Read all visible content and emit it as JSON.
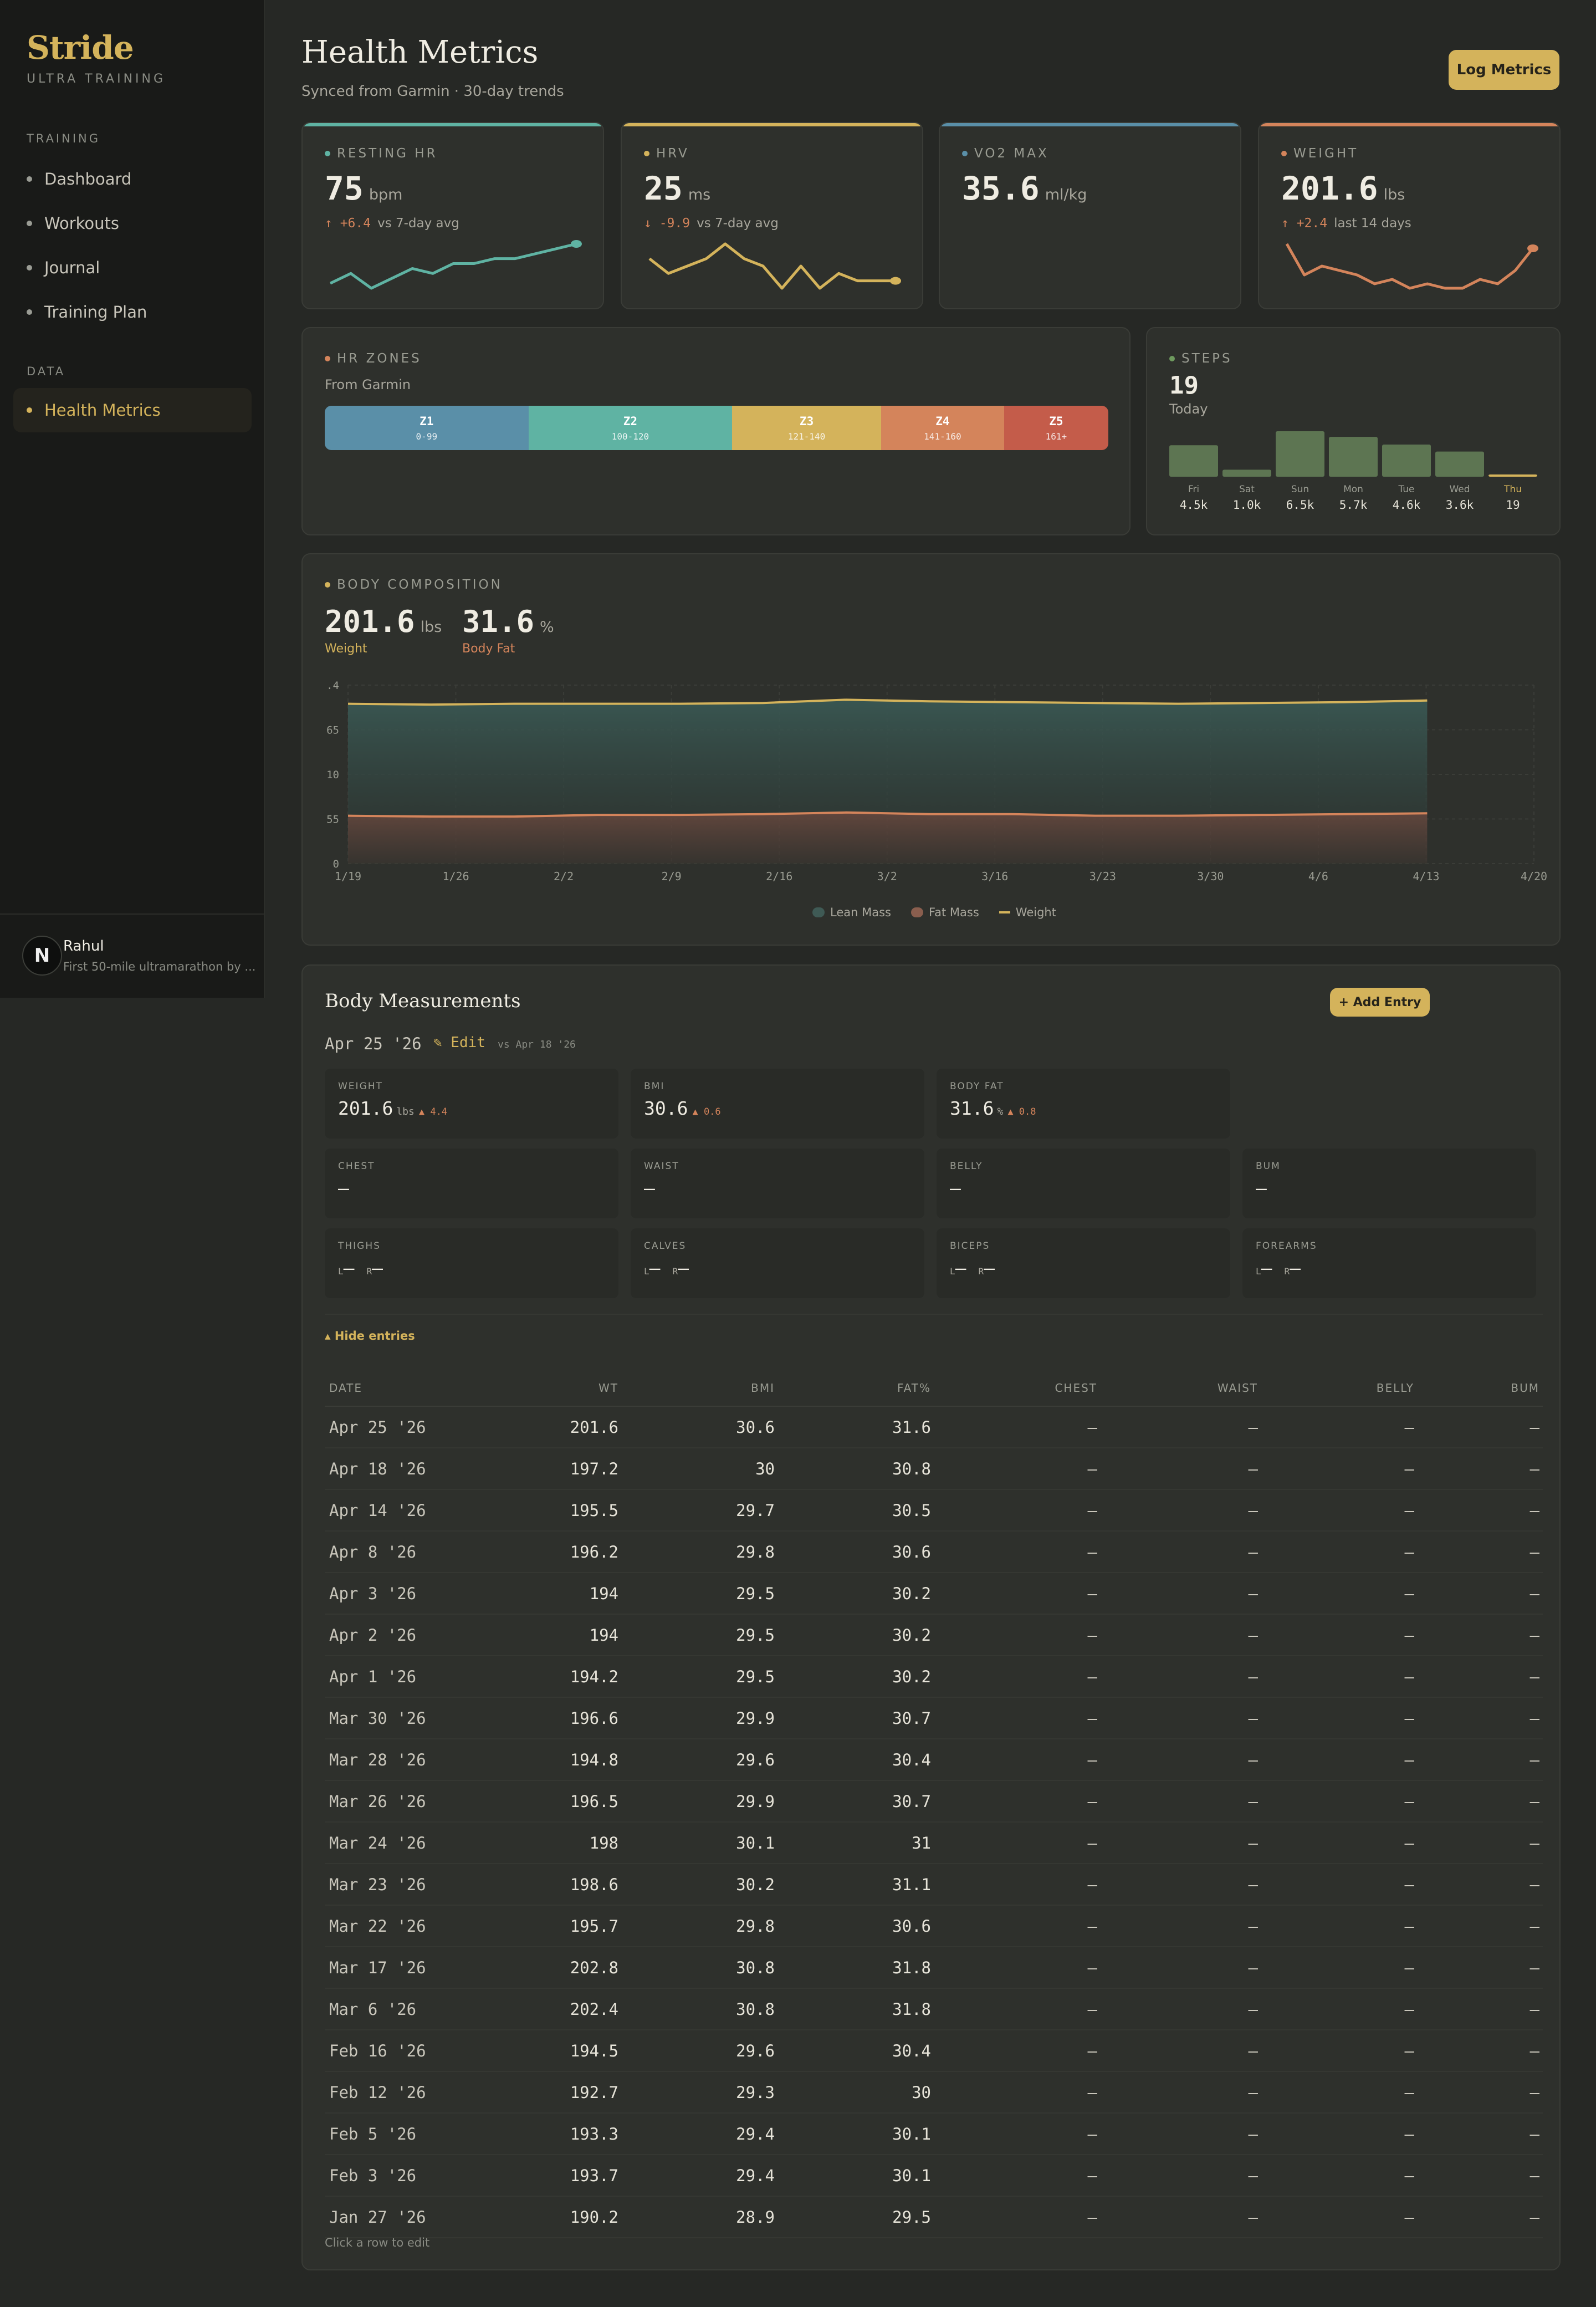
{
  "app": {
    "name": "Stride",
    "tagline": "ULTRA TRAINING"
  },
  "sidebar": {
    "sections": [
      {
        "title": "TRAINING",
        "items": [
          "Dashboard",
          "Workouts",
          "Journal",
          "Training Plan"
        ]
      },
      {
        "title": "DATA",
        "items": [
          "Health Metrics"
        ]
      }
    ],
    "active": "Health Metrics"
  },
  "user": {
    "initial": "N",
    "name": "Rahul",
    "goal": "First 50-mile ultramarathon by ..."
  },
  "header": {
    "title": "Health Metrics",
    "subtitle": "Synced from Garmin · 30-day trends",
    "log_button": "Log Metrics"
  },
  "colors": {
    "teal": "#5fb3a3",
    "gold": "#d4b35b",
    "blue": "#5a8fa8",
    "orange": "#d4845b",
    "green": "#6e9a5e"
  },
  "kpis": [
    {
      "title": "RESTING HR",
      "value": "75",
      "unit": "bpm",
      "delta": "↑ +6.4",
      "compare": "vs 7-day avg",
      "color": "#5fb3a3",
      "spark": [
        3,
        5,
        2,
        4,
        6,
        5,
        7,
        7,
        8,
        8,
        9,
        10,
        11
      ]
    },
    {
      "title": "HRV",
      "value": "25",
      "unit": "ms",
      "delta": "↓ -9.9",
      "compare": "vs 7-day avg",
      "color": "#d4b35b",
      "spark": [
        6,
        4,
        5,
        6,
        8,
        6,
        5,
        2,
        5,
        2,
        4,
        3,
        3,
        3
      ]
    },
    {
      "title": "VO2 MAX",
      "value": "35.6",
      "unit": "ml/kg",
      "delta": "",
      "compare": "",
      "color": "#5a8fa8",
      "spark": []
    },
    {
      "title": "WEIGHT",
      "value": "201.6",
      "unit": "lbs",
      "delta": "↑ +2.4",
      "compare": "last 14 days",
      "color": "#d4845b",
      "spark": [
        10,
        3,
        5,
        4,
        3,
        1,
        2,
        0,
        1,
        0,
        0,
        2,
        1,
        4,
        9
      ]
    }
  ],
  "hr_zones": {
    "title": "HR ZONES",
    "source": "From Garmin",
    "zones": [
      {
        "name": "Z1",
        "range": "0-99",
        "color": "#5a8fa8",
        "share": 0.26
      },
      {
        "name": "Z2",
        "range": "100-120",
        "color": "#5fb3a3",
        "share": 0.26
      },
      {
        "name": "Z3",
        "range": "121-140",
        "color": "#d4b35b",
        "share": 0.19
      },
      {
        "name": "Z4",
        "range": "141-160",
        "color": "#d4845b",
        "share": 0.157
      },
      {
        "name": "Z5",
        "range": "161+",
        "color": "#c45c4a",
        "share": 0.133
      }
    ]
  },
  "steps": {
    "title": "STEPS",
    "today_value": "19",
    "today_label": "Today",
    "days": [
      {
        "day": "Fri",
        "label": "4.5k",
        "value": 4500
      },
      {
        "day": "Sat",
        "label": "1.0k",
        "value": 1000
      },
      {
        "day": "Sun",
        "label": "6.5k",
        "value": 6500
      },
      {
        "day": "Mon",
        "label": "5.7k",
        "value": 5700
      },
      {
        "day": "Tue",
        "label": "4.6k",
        "value": 4600
      },
      {
        "day": "Wed",
        "label": "3.6k",
        "value": 3600
      },
      {
        "day": "Thu",
        "label": "19",
        "value": 19
      }
    ]
  },
  "body_comp": {
    "title": "BODY COMPOSITION",
    "weight_value": "201.6",
    "weight_unit": "lbs",
    "weight_label": "Weight",
    "fat_value": "31.6",
    "fat_unit": "%",
    "fat_label": "Body Fat",
    "legend": [
      "Lean Mass",
      "Fat Mass",
      "Weight"
    ]
  },
  "chart_data": {
    "type": "area",
    "x": [
      "1/19",
      "1/26",
      "2/2",
      "2/9",
      "2/16",
      "2/23",
      "3/2",
      "3/9",
      "3/16",
      "3/23",
      "3/30",
      "4/6",
      "4/13",
      "4/17"
    ],
    "x_tick_labels": [
      "1/19",
      "1/26",
      "2/2",
      "2/9",
      "2/16",
      "3/2",
      "3/16",
      "3/23",
      "3/30",
      "4/6",
      "4/13",
      "4/20"
    ],
    "y_tick_labels": [
      ".4",
      "65",
      "10",
      "55",
      "0"
    ],
    "ylim": [
      0,
      220
    ],
    "series": [
      {
        "name": "Lean Mass",
        "values": [
          138,
          138,
          137,
          136,
          137,
          135,
          138,
          138,
          137,
          138,
          139,
          139,
          138,
          139
        ]
      },
      {
        "name": "Fat Mass",
        "values": [
          59,
          58,
          58,
          60,
          60,
          61,
          63,
          61,
          61,
          59,
          59,
          60,
          61,
          62
        ]
      },
      {
        "name": "Weight",
        "values": [
          197,
          196,
          197,
          197,
          197,
          198,
          202,
          200,
          199,
          198,
          197,
          198,
          199,
          201
        ]
      }
    ],
    "grid": true,
    "legend": "bottom-center"
  },
  "measurements": {
    "title": "Body Measurements",
    "add_button": "+ Add Entry",
    "date": "Apr 25 '26",
    "edit": "✎ Edit",
    "compare": "vs Apr 18 '26",
    "cards": [
      {
        "label": "WEIGHT",
        "value": "201.6",
        "unit": "lbs",
        "delta": "▲ 4.4"
      },
      {
        "label": "BMI",
        "value": "30.6",
        "unit": "",
        "delta": "▲ 0.6"
      },
      {
        "label": "BODY FAT",
        "value": "31.6",
        "unit": "%",
        "delta": "▲ 0.8"
      },
      {
        "label": "CHEST",
        "value": "—"
      },
      {
        "label": "WAIST",
        "value": "—"
      },
      {
        "label": "BELLY",
        "value": "—"
      },
      {
        "label": "BUM",
        "value": "—"
      },
      {
        "label": "THIGHS",
        "lr": true
      },
      {
        "label": "CALVES",
        "lr": true
      },
      {
        "label": "BICEPS",
        "lr": true
      },
      {
        "label": "FOREARMS",
        "lr": true
      }
    ],
    "lr_left": "L",
    "lr_right": "R",
    "lr_dash": "—",
    "toggle": "▴ Hide entries",
    "columns": [
      "DATE",
      "WT",
      "BMI",
      "FAT%",
      "CHEST",
      "WAIST",
      "BELLY",
      "BUM"
    ],
    "rows": [
      [
        "Apr 25 '26",
        "201.6",
        "30.6",
        "31.6",
        "—",
        "—",
        "—",
        "—"
      ],
      [
        "Apr 18 '26",
        "197.2",
        "30",
        "30.8",
        "—",
        "—",
        "—",
        "—"
      ],
      [
        "Apr 14 '26",
        "195.5",
        "29.7",
        "30.5",
        "—",
        "—",
        "—",
        "—"
      ],
      [
        "Apr 8 '26",
        "196.2",
        "29.8",
        "30.6",
        "—",
        "—",
        "—",
        "—"
      ],
      [
        "Apr 3 '26",
        "194",
        "29.5",
        "30.2",
        "—",
        "—",
        "—",
        "—"
      ],
      [
        "Apr 2 '26",
        "194",
        "29.5",
        "30.2",
        "—",
        "—",
        "—",
        "—"
      ],
      [
        "Apr 1 '26",
        "194.2",
        "29.5",
        "30.2",
        "—",
        "—",
        "—",
        "—"
      ],
      [
        "Mar 30 '26",
        "196.6",
        "29.9",
        "30.7",
        "—",
        "—",
        "—",
        "—"
      ],
      [
        "Mar 28 '26",
        "194.8",
        "29.6",
        "30.4",
        "—",
        "—",
        "—",
        "—"
      ],
      [
        "Mar 26 '26",
        "196.5",
        "29.9",
        "30.7",
        "—",
        "—",
        "—",
        "—"
      ],
      [
        "Mar 24 '26",
        "198",
        "30.1",
        "31",
        "—",
        "—",
        "—",
        "—"
      ],
      [
        "Mar 23 '26",
        "198.6",
        "30.2",
        "31.1",
        "—",
        "—",
        "—",
        "—"
      ],
      [
        "Mar 22 '26",
        "195.7",
        "29.8",
        "30.6",
        "—",
        "—",
        "—",
        "—"
      ],
      [
        "Mar 17 '26",
        "202.8",
        "30.8",
        "31.8",
        "—",
        "—",
        "—",
        "—"
      ],
      [
        "Mar 6 '26",
        "202.4",
        "30.8",
        "31.8",
        "—",
        "—",
        "—",
        "—"
      ],
      [
        "Feb 16 '26",
        "194.5",
        "29.6",
        "30.4",
        "—",
        "—",
        "—",
        "—"
      ],
      [
        "Feb 12 '26",
        "192.7",
        "29.3",
        "30",
        "—",
        "—",
        "—",
        "—"
      ],
      [
        "Feb 5 '26",
        "193.3",
        "29.4",
        "30.1",
        "—",
        "—",
        "—",
        "—"
      ],
      [
        "Feb 3 '26",
        "193.7",
        "29.4",
        "30.1",
        "—",
        "—",
        "—",
        "—"
      ],
      [
        "Jan 27 '26",
        "190.2",
        "28.9",
        "29.5",
        "—",
        "—",
        "—",
        "—"
      ]
    ],
    "footer": "Click a row to edit"
  }
}
